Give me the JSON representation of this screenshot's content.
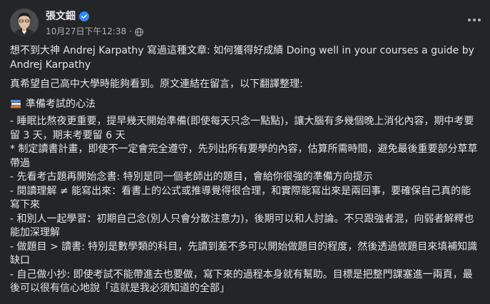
{
  "author": {
    "name": "張文鈿",
    "timestamp": "10月27日下午12:38",
    "separator": "·"
  },
  "icons": {
    "verified": "verified-badge-icon",
    "audience": "globe-icon",
    "more": "more-options-icon",
    "section": "books-icon"
  },
  "colors": {
    "background": "#242526",
    "text": "#e4e6eb",
    "secondary_text": "#b0b3b8",
    "verified": "#2d88ff"
  },
  "post": {
    "intro_line1": "想不到大神 Andrej Karpathy 寫過這種文章:  如何獲得好成績 Doing well in your courses a guide by",
    "intro_line2": "Andrej Karpathy",
    "intro2": "真希望自己高中大學時能夠看到。原文連結在留言，以下翻譯整理:",
    "section_title": "準備考試的心法",
    "items": [
      "- 睡眠比熬夜更重要，提早幾天開始準備(即使每天只念一點點)，讓大腦有多幾個晚上消化內容，期中考要留 3 天，期末考要留 6 天",
      "* 制定讀書計畫，即使不一定會完全遵守，先列出所有要學的內容，估算所需時間，避免最後重要部分草草帶過",
      "- 先看考古題再開始念書: 特別是同一個老師出的題目，會給你很強的準備方向提示",
      "- 閱讀理解 ≠ 能寫出來：看書上的公式或推導覺得很合理，和實際能寫出來是兩回事，要確保自己真的能寫下來",
      "- 和別人一起學習：初期自己念(別人只會分散注意力)，後期可以和人討論。不只跟強者混，向弱者解釋也能加深理解",
      "- 做題目 > 讀書: 特別是數學類的科目，先讀到差不多可以開始做題目的程度，然後透過做題目來填補知識缺口",
      "- 自己做小抄: 即使考試不能帶進去也要做，寫下來的過程本身就有幫助。目標是把整門課塞進一兩頁，最後可以很有信心地說「這就是我必須知道的全部」"
    ]
  }
}
